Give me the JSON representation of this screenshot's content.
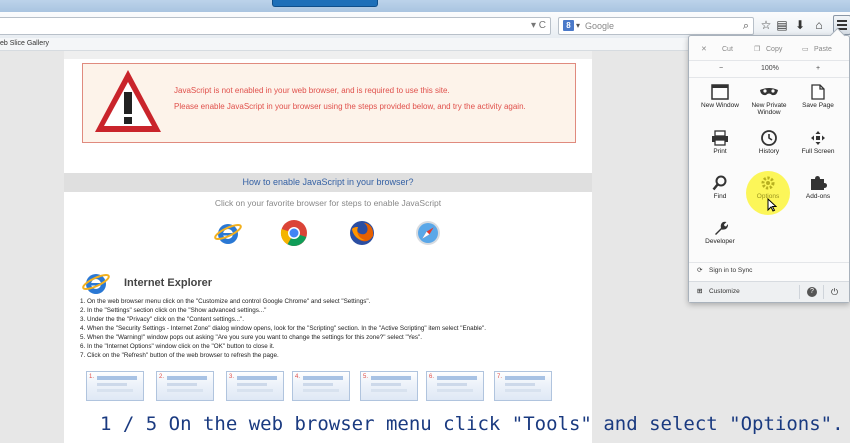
{
  "browser": {
    "search_placeholder": "Google",
    "search_engine_badge": "8",
    "bookmark_item": "eb Slice Gallery"
  },
  "page": {
    "warning_line1": "JavaScript is not enabled in your web browser, and is required to use this site.",
    "warning_line2": "Please enable JavaScript in your browser using the steps provided below, and try the activity again.",
    "how_heading": "How to enable JavaScript in your browser?",
    "click_instruction": "Click on your favorite browser for steps to enable JavaScript",
    "section_title": "Internet Explorer",
    "steps": [
      "1. On the web browser menu click on the \"Customize and control Google Chrome\" and select \"Settings\".",
      "2. In the \"Settings\" section click on the \"Show advanced settings...\"",
      "3. Under the the \"Privacy\" click on the \"Content settings...\".",
      "4. When the \"Security Settings - Internet Zone\" dialog window opens, look for the \"Scripting\" section. In the \"Active Scripting\" item select \"Enable\".",
      "5. When the \"Warning!\" window pops out asking \"Are you sure you want to change the settings for this zone?\" select \"Yes\".",
      "6. In the \"Internet Options\" window click on the \"OK\" button to close it.",
      "7. Click on the \"Refresh\" button of the web browser to refresh the page."
    ],
    "thumbnails": [
      "1.",
      "2.",
      "3.",
      "4.",
      "5.",
      "6.",
      "7."
    ]
  },
  "caption": "1 / 5  On the web browser menu click \"Tools\" and select \"Options\".",
  "menu_panel": {
    "cut": "Cut",
    "copy": "Copy",
    "paste": "Paste",
    "zoom_minus": "−",
    "zoom_level": "100%",
    "zoom_plus": "+",
    "tiles": {
      "new_window": "New Window",
      "new_private_1": "New Private",
      "new_private_2": "Window",
      "save_page": "Save Page",
      "print": "Print",
      "history": "History",
      "full_screen": "Full Screen",
      "find": "Find",
      "options": "Options",
      "addons": "Add-ons",
      "developer": "Developer"
    },
    "sign_in": "Sign in to Sync",
    "customize": "Customize",
    "help": "?",
    "highlight_color": "#fcf53c"
  },
  "colors": {
    "warning_text": "#e0504b",
    "heading_blue": "#3561a4",
    "caption_blue": "#1a3a80"
  }
}
